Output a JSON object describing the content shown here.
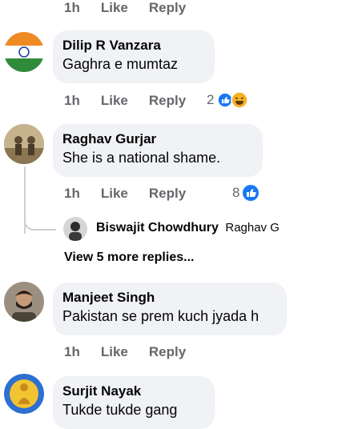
{
  "top_actions": {
    "time": "1h",
    "like": "Like",
    "reply": "Reply"
  },
  "comments": [
    {
      "author": "Dilip R Vanzara",
      "text": "Gaghra e mumtaz",
      "time": "1h",
      "like": "Like",
      "reply": "Reply",
      "reaction_count": "2",
      "reactions": [
        "like-icon",
        "haha-icon"
      ]
    },
    {
      "author": "Raghav Gurjar",
      "text": "She is a national shame.",
      "time": "1h",
      "like": "Like",
      "reply": "Reply",
      "reaction_count": "8",
      "reactions": [
        "like-icon"
      ],
      "reply_preview": {
        "author": "Biswajit Chowdhury",
        "text": "Raghav G"
      },
      "view_more": "View 5 more replies..."
    },
    {
      "author": "Manjeet Singh",
      "text": "Pakistan se prem kuch jyada h",
      "time": "1h",
      "like": "Like",
      "reply": "Reply"
    },
    {
      "author": "Surjit Nayak",
      "text": "Tukde tukde gang"
    }
  ],
  "colors": {
    "bubble": "#f0f2f5",
    "meta": "#65676b",
    "like_blue": "#1877f2",
    "haha_yellow": "#f7b125"
  }
}
